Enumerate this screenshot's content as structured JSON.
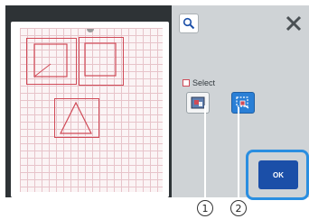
{
  "panel": {
    "select_label": "Select",
    "ok_label": "OK"
  },
  "icons": {
    "zoom": "magnifier-icon",
    "close": "close-icon",
    "select_all": "select-all-icon",
    "select_area": "select-area-icon"
  },
  "callouts": {
    "first": "1",
    "second": "2"
  },
  "colors": {
    "screen_bg": "#2e3336",
    "panel_bg": "#cfd3d6",
    "accent_blue": "#2a7fd6",
    "ok_blue": "#1b4fa8",
    "shape_red": "#d04a57",
    "highlight_outline": "#2a8ee0"
  }
}
